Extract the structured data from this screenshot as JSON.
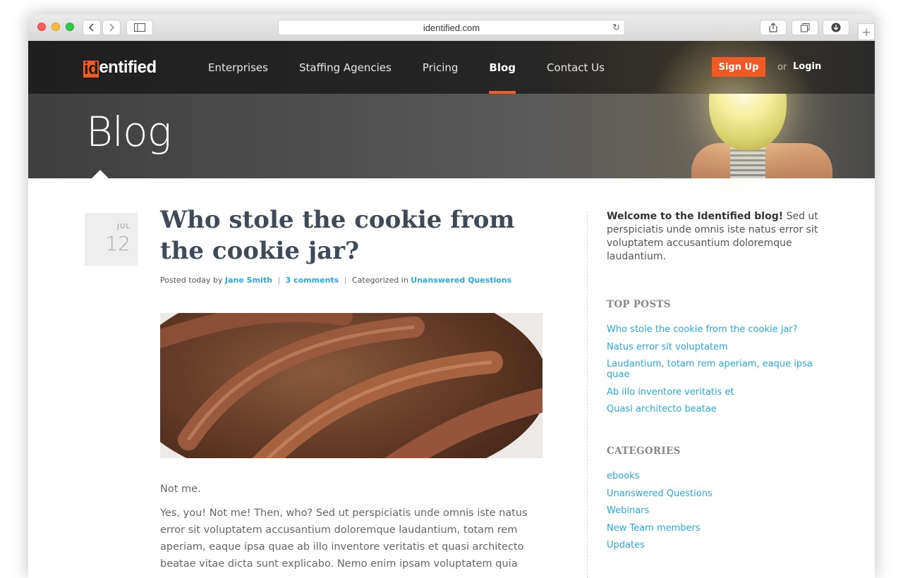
{
  "browser": {
    "url": "identified.com",
    "back_icon": "chevron-left-icon",
    "forward_icon": "chevron-right-icon"
  },
  "site": {
    "logo_mark": "id",
    "logo_rest": "entified",
    "nav": [
      {
        "label": "Enterprises",
        "active": false
      },
      {
        "label": "Staffing Agencies",
        "active": false
      },
      {
        "label": "Pricing",
        "active": false
      },
      {
        "label": "Blog",
        "active": true
      },
      {
        "label": "Contact Us",
        "active": false
      }
    ],
    "signup_label": "Sign Up",
    "or_text": "or",
    "login_label": "Login",
    "accent_color": "#f15a24",
    "link_color": "#29a9e0"
  },
  "hero": {
    "title": "Blog"
  },
  "post": {
    "date_month": "JUL",
    "date_day": "12",
    "title": "Who stole the cookie from the cookie jar?",
    "meta_prefix": "Posted today by",
    "author": "Jane Smith",
    "comments": "3 comments",
    "category_prefix": "Categorized in",
    "category": "Unanswered Questions",
    "body": [
      "Not me.",
      "Yes, you! Not me! Then, who? Sed ut perspiciatis unde omnis iste natus error sit voluptatem accusantium doloremque laudantium, totam rem aperiam, eaque ipsa quae ab illo inventore veritatis et quasi architecto beatae vitae dicta sunt explicabo. Nemo enim ipsam voluptatem quia"
    ]
  },
  "sidebar": {
    "welcome_bold": "Welcome to the Identified blog!",
    "welcome_text": " Sed ut perspiciatis unde omnis iste natus error sit voluptatem accusantium doloremque laudantium.",
    "top_posts_heading": "TOP POSTS",
    "top_posts": [
      "Who stole the cookie from the cookie jar?",
      "Natus error sit voluptatem",
      "Laudantium, totam rem aperiam, eaque ipsa quae",
      "Ab illo inventore veritatis et",
      "Quasi architecto beatae"
    ],
    "categories_heading": "CATEGORIES",
    "categories": [
      "ebooks",
      "Unanswered Questions",
      "Webinars",
      "New Team members",
      "Updates"
    ]
  }
}
